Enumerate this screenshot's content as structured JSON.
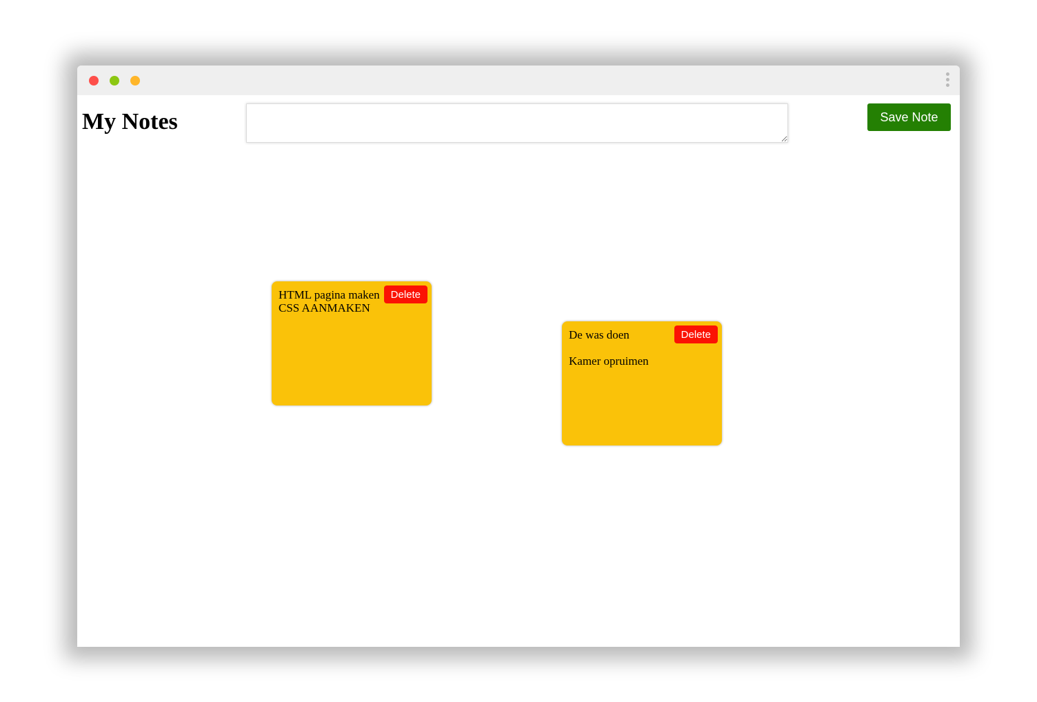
{
  "window": {
    "traffic_lights": {
      "red": "#fe4f4a",
      "green": "#8cc712",
      "yellow": "#ffb62a"
    }
  },
  "header": {
    "title": "My Notes",
    "input_value": "",
    "save_label": "Save Note"
  },
  "notes": [
    {
      "text": "HTML pagina maken\nCSS AANMAKEN",
      "delete_label": "Delete"
    },
    {
      "text": "De was doen\n\nKamer opruimen",
      "delete_label": "Delete"
    }
  ],
  "colors": {
    "note_bg": "#fac209",
    "save_bg": "#248003",
    "delete_bg": "#fb1204"
  }
}
